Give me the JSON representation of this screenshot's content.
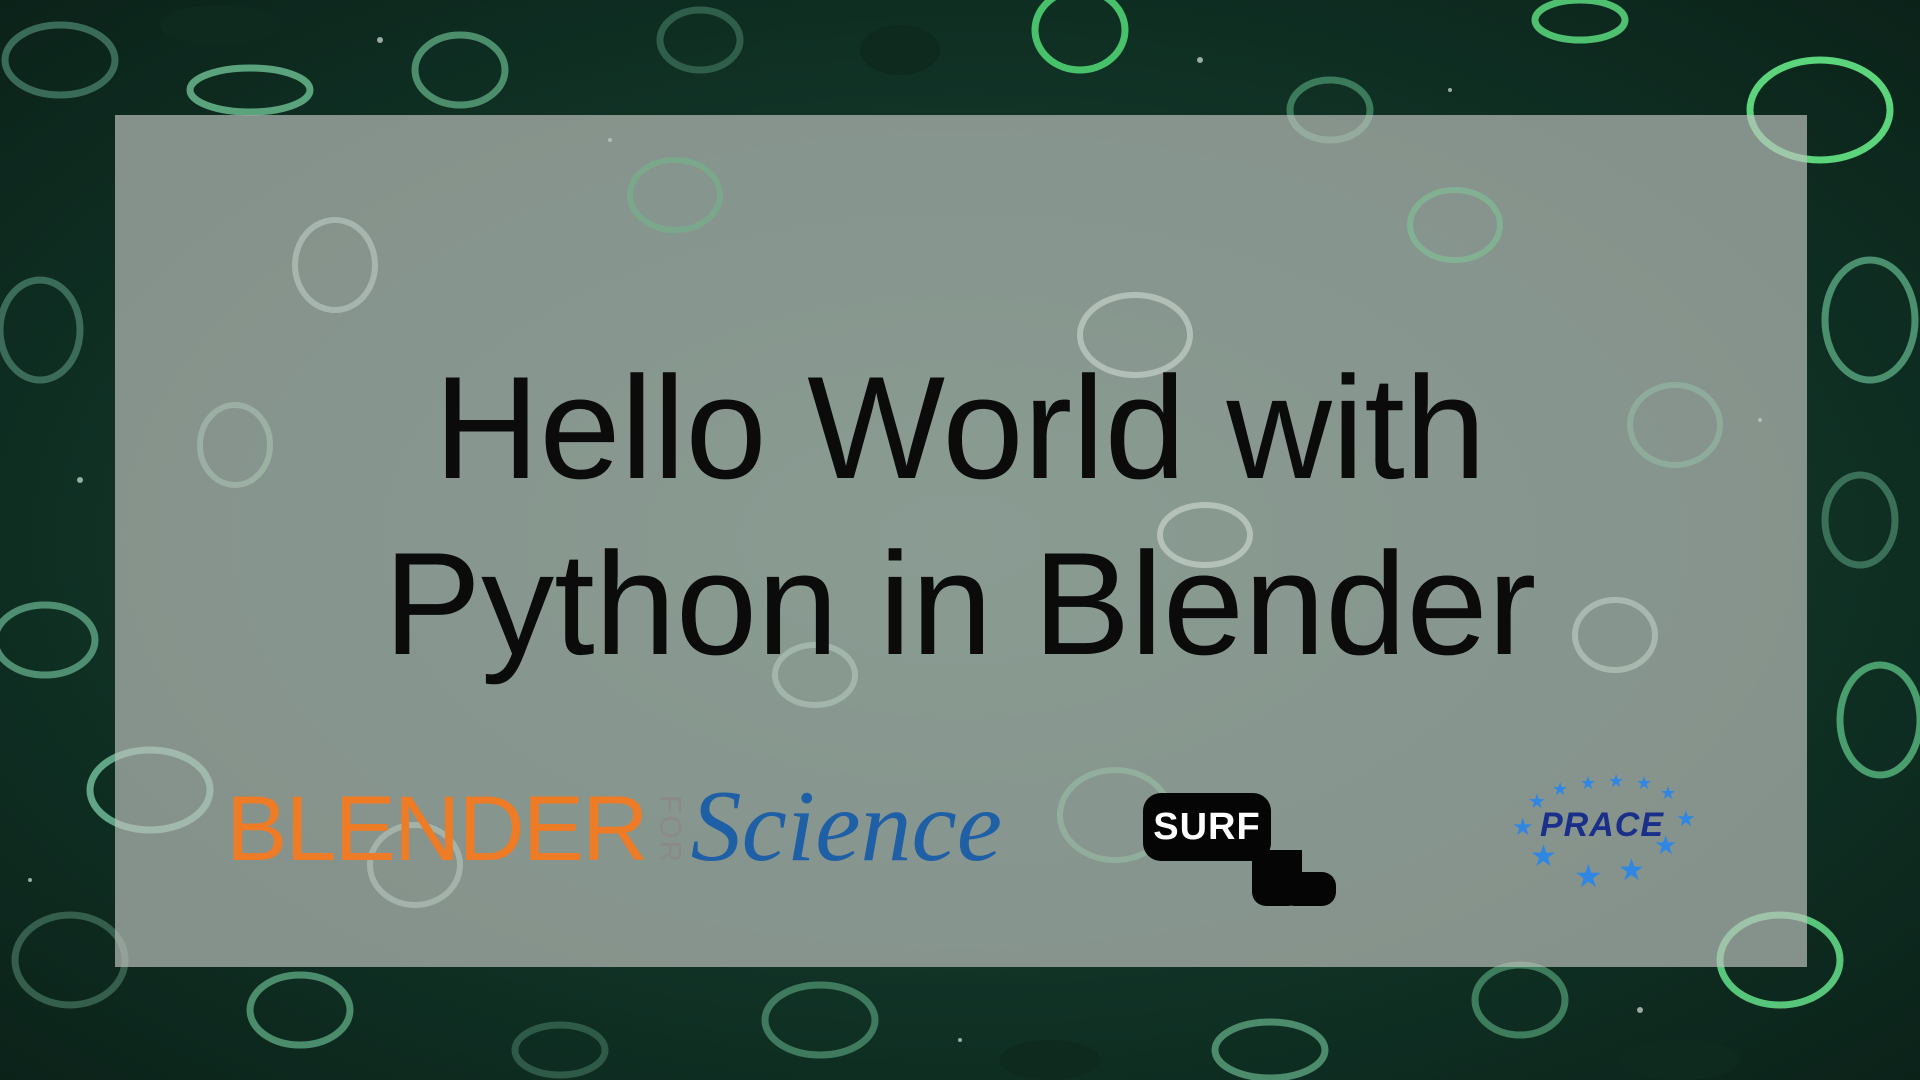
{
  "slide": {
    "title_line1": "Hello World with",
    "title_line2": "Python in Blender"
  },
  "logos": {
    "blender_for_science": {
      "blender": "BLENDER",
      "for": "FOR",
      "science": "Science"
    },
    "surf": "SURF",
    "prace": "PRACE"
  },
  "colors": {
    "background": "#12382a",
    "panel": "#bec2be",
    "title_text": "#0b0b0b",
    "blender_orange": "#ee7b26",
    "science_blue": "#1f5fa6",
    "surf_black": "#050505",
    "prace_text": "#1a2f8a",
    "prace_stars": "#2f86e3"
  }
}
